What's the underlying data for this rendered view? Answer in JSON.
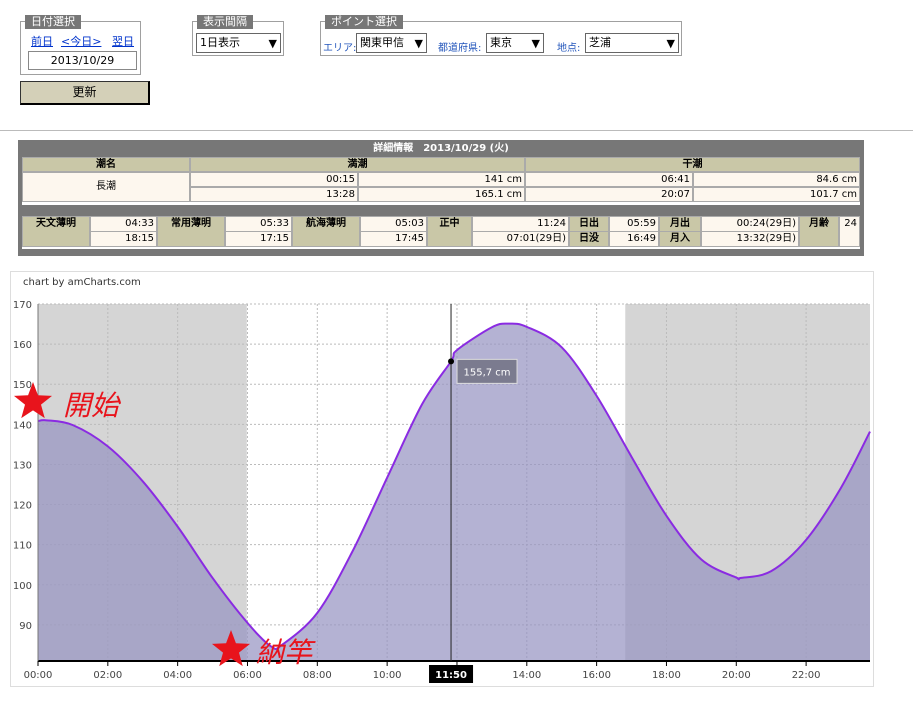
{
  "date_panel": {
    "legend": "日付選択",
    "prev": "前日",
    "today": "<今日>",
    "next": "翌日",
    "date": "2013/10/29",
    "update": "更新"
  },
  "interval_panel": {
    "legend": "表示間隔",
    "value": "1日表示"
  },
  "point_panel": {
    "legend": "ポイント選択",
    "area_label": "エリア:",
    "area_value": "関東甲信",
    "pref_label": "都道府県:",
    "pref_value": "東京",
    "spot_label": "地点:",
    "spot_value": "芝浦"
  },
  "detail": {
    "title": "詳細情報　2013/10/29 (火)",
    "col_tide": "潮名",
    "col_high": "満潮",
    "col_low": "干潮",
    "tide_name": "長潮",
    "high": [
      {
        "time": "00:15",
        "level": "141 cm"
      },
      {
        "time": "13:28",
        "level": "165.1 cm"
      }
    ],
    "low": [
      {
        "time": "06:41",
        "level": "84.6 cm"
      },
      {
        "time": "20:07",
        "level": "101.7 cm"
      }
    ],
    "astro_twilight": "天文薄明",
    "astro_am": "04:33",
    "astro_pm": "18:15",
    "civil_twilight": "常用薄明",
    "civil_am": "05:33",
    "civil_pm": "17:15",
    "naut_twilight": "航海薄明",
    "naut_am": "05:03",
    "naut_pm": "17:45",
    "noon": "正中",
    "noon_sun": "11:24",
    "noon_moon": "07:01(29日)",
    "sunrise_label": "日出",
    "sunrise": "05:59",
    "sunset_label": "日没",
    "sunset": "16:49",
    "moonrise_label": "月出",
    "moonrise": "00:24(29日)",
    "moonset_label": "月入",
    "moonset": "13:32(29日)",
    "moon_age_label": "月齢",
    "moon_age": "24"
  },
  "chart_credit": "chart by amCharts.com",
  "annotations": {
    "start": "開始",
    "end": "納竿"
  },
  "chart_data": {
    "type": "area",
    "title": "",
    "xlabel": "",
    "ylabel": "",
    "x_ticks": [
      "00:00",
      "02:00",
      "04:00",
      "06:00",
      "08:00",
      "10:00",
      "12:00",
      "14:00",
      "16:00",
      "18:00",
      "20:00",
      "22:00"
    ],
    "y_ticks": [
      90,
      100,
      110,
      120,
      130,
      140,
      150,
      160,
      170
    ],
    "xlim": [
      0,
      23.83
    ],
    "ylim": [
      81,
      170
    ],
    "x": [
      0,
      0.25,
      1,
      2,
      3,
      4,
      5,
      6,
      6.68,
      7,
      8,
      9,
      10,
      11,
      11.83,
      12,
      13,
      13.47,
      14,
      15,
      16,
      17,
      18,
      19,
      20,
      20.12,
      21,
      22,
      23,
      23.83
    ],
    "y": [
      140.8,
      141,
      139.8,
      134.5,
      125.8,
      114.5,
      101.7,
      90.5,
      84.6,
      85.1,
      93,
      108.2,
      126.7,
      145,
      155.7,
      158.5,
      164.2,
      165.1,
      164.3,
      159.2,
      147.1,
      131.9,
      117.2,
      106.3,
      101.8,
      101.7,
      103.4,
      111.2,
      124.2,
      138.2
    ],
    "night_bands": [
      [
        0,
        5.98
      ],
      [
        16.82,
        23.83
      ]
    ],
    "cursor": {
      "x": 11.83,
      "y": 155.7,
      "time_label": "11:50",
      "value_label": "155,7 cm"
    },
    "fill_color": "#9794c2",
    "line_color": "#8a2be2",
    "night_color": "#d5d5d5",
    "grid": true,
    "legend": "none"
  }
}
